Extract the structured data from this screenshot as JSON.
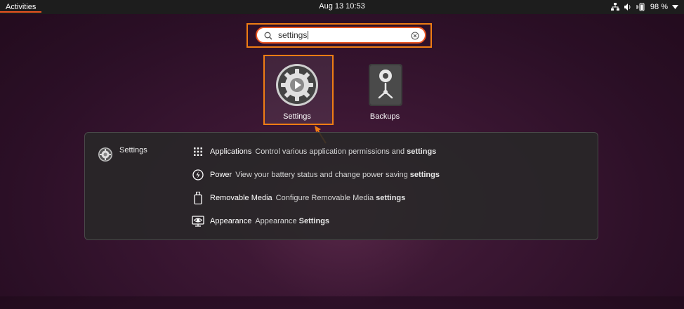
{
  "topbar": {
    "activities_label": "Activities",
    "clock": "Aug 13  10:53",
    "battery_percent": "98 %",
    "icons": [
      "network-icon",
      "volume-icon",
      "battery-icon",
      "system-menu-arrow-icon"
    ]
  },
  "search": {
    "value": "settings",
    "icons": [
      "search-icon",
      "clear-icon"
    ]
  },
  "apps": [
    {
      "label": "Settings",
      "icon": "settings-gear-icon"
    },
    {
      "label": "Backups",
      "icon": "backups-icon"
    }
  ],
  "provider": {
    "name": "Settings",
    "icon": "settings-gear-icon",
    "results": [
      {
        "title": "Applications",
        "desc": "Control various application permissions and",
        "bold": "settings",
        "icon": "grid-icon"
      },
      {
        "title": "Power",
        "desc": "View your battery status and change power saving",
        "bold": "settings",
        "icon": "power-icon"
      },
      {
        "title": "Removable Media",
        "desc": "Configure Removable Media",
        "bold": "settings",
        "icon": "usb-drive-icon"
      },
      {
        "title": "Appearance",
        "desc": "Appearance",
        "bold": "Settings",
        "icon": "appearance-icon"
      }
    ]
  },
  "colors": {
    "highlight": "#ef7d14",
    "accent": "#e95420",
    "topbar_bg": "#1d1d1d"
  }
}
